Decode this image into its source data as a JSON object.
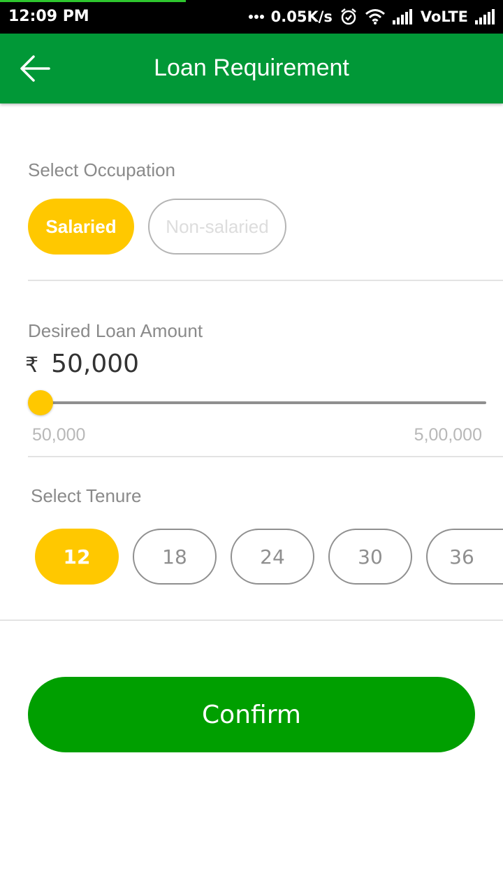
{
  "status_bar": {
    "time": "12:09 PM",
    "speed": "0.05K/s",
    "network": "VoLTE",
    "icons": [
      "dots-icon",
      "alarm-icon",
      "wifi-icon",
      "signal-icon",
      "signal-icon"
    ]
  },
  "app_bar": {
    "title": "Loan Requirement",
    "back_icon": "arrow-left-icon",
    "background": "#019837"
  },
  "occupation": {
    "label": "Select Occupation",
    "options": [
      "Salaried",
      "Non-salaried"
    ],
    "selected": "Salaried"
  },
  "loan_amount": {
    "label": "Desired Loan Amount",
    "currency_symbol": "₹",
    "value": "50,000",
    "min_label": "50,000",
    "max_label": "5,00,000",
    "slider_fraction": 0
  },
  "tenure": {
    "label": "Select Tenure",
    "options": [
      "12",
      "18",
      "24",
      "30",
      "36"
    ],
    "selected": "12"
  },
  "confirm": {
    "label": "Confirm"
  },
  "colors": {
    "accent": "#ffc800",
    "primary_green": "#009f00"
  }
}
